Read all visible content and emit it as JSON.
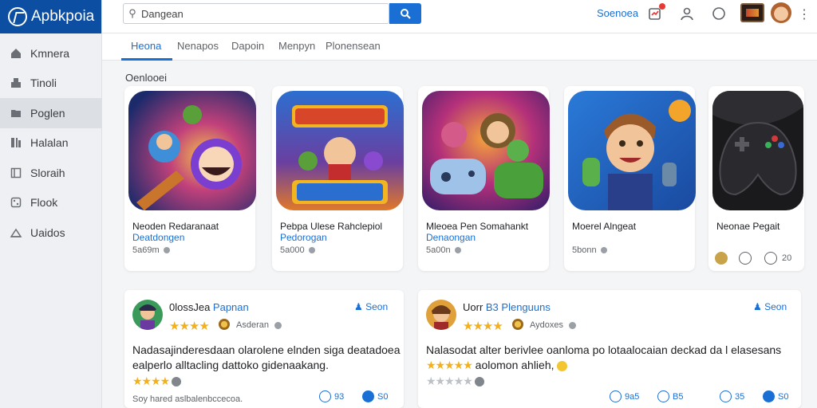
{
  "app": {
    "name": "Apbkpoia"
  },
  "sidebar": {
    "items": [
      {
        "label": "Kmnera",
        "icon": "home-icon"
      },
      {
        "label": "Tinoli",
        "icon": "grid-icon"
      },
      {
        "label": "Poglen",
        "icon": "folder-icon"
      },
      {
        "label": "Halalan",
        "icon": "library-icon"
      },
      {
        "label": "Sloraih",
        "icon": "book-icon"
      },
      {
        "label": "Flook",
        "icon": "dice-icon"
      },
      {
        "label": "Uaidos",
        "icon": "cloud-icon"
      }
    ],
    "active_index": 2
  },
  "header": {
    "search_value": "Dangean",
    "link_label": "Soenoea"
  },
  "tabs": [
    "Heona",
    "Nenapos",
    "Dapoin",
    "Menpyn",
    "Plonensean"
  ],
  "section_title": "Oenlooei",
  "cards": [
    {
      "title": "Neoden Redaranaat",
      "developer": "Deatdongen",
      "meta": "5a69m"
    },
    {
      "title": "Pebpa Ulese Rahclepiol",
      "developer": "Pedorogan",
      "meta": "5a000"
    },
    {
      "title": "Mleoea Pen Somahankt",
      "developer": "Denaongan",
      "meta": "5a00n"
    },
    {
      "title": "Moerel Alngeat",
      "developer": "",
      "meta": "5bonn"
    },
    {
      "title": "Neonae Pegait",
      "developer": "",
      "meta": "20"
    }
  ],
  "reviews": [
    {
      "name_plain": "0lossJea ",
      "name_accent": "Papnan",
      "follow": "Seon",
      "developer": "Asderan",
      "text_line1": "Nadasajinderesdaan olarolene elnden siga deatadoea",
      "text_line2": "ealperlo alltacling dattoko gidenaakang.",
      "caption": "Soy hared aslbalenbccecoa.",
      "actions": [
        "93",
        "S0"
      ],
      "stars": 4
    },
    {
      "name_plain": "Uorr ",
      "name_accent": "B3 Plenguuns",
      "follow": "Seon",
      "developer": "Aydoxes",
      "text_line1": "Nalasodat alter berivlee oanloma po lotaalocaian deckad da l elasesans",
      "text_line2": "aolomon ahlieh,",
      "caption": "",
      "actions": [
        "9a5",
        "B5",
        "35",
        "S0"
      ],
      "stars": 5
    }
  ]
}
